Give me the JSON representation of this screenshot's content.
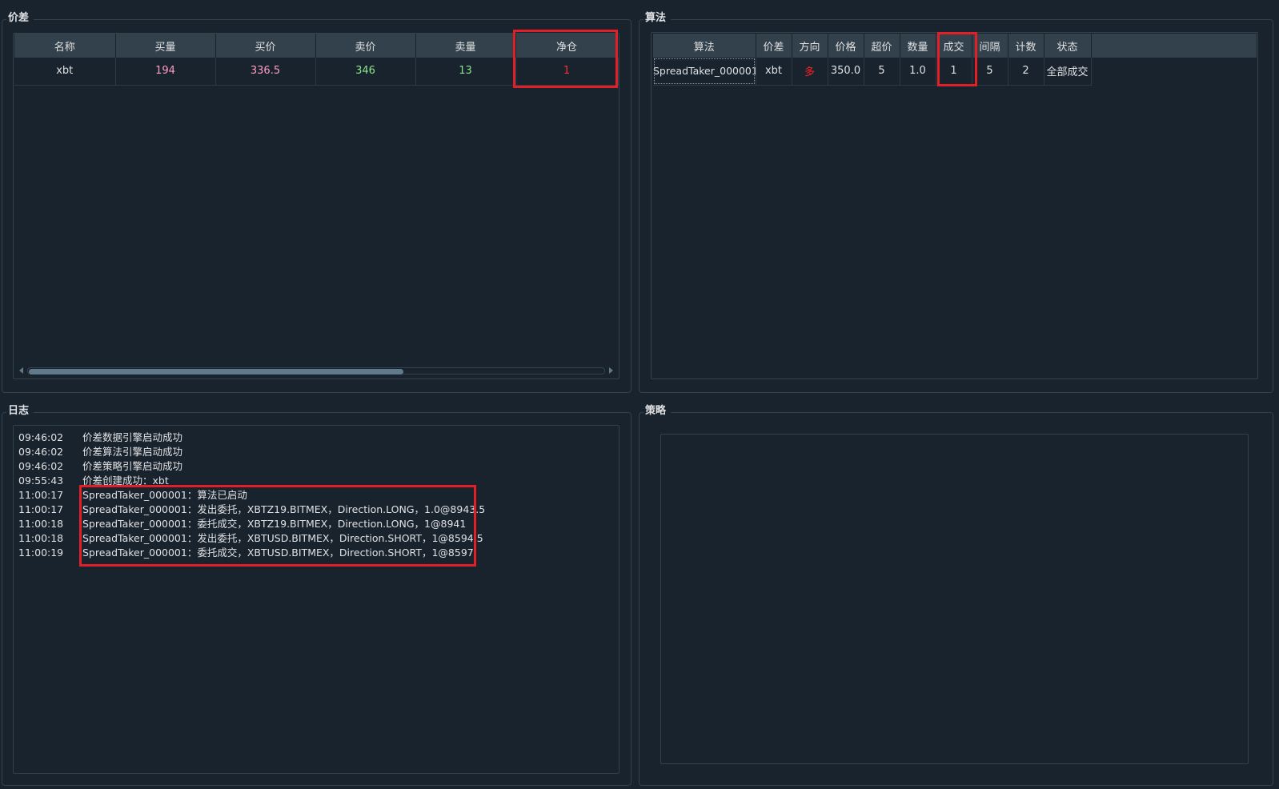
{
  "panels": {
    "spread": "价差",
    "algo": "算法",
    "log": "日志",
    "strategy": "策略"
  },
  "spread_table": {
    "headers": [
      "名称",
      "买量",
      "买价",
      "卖价",
      "卖量",
      "净仓"
    ],
    "rows": [
      {
        "name": "xbt",
        "bid_volume": "194",
        "bid_price": "336.5",
        "ask_price": "346",
        "ask_volume": "13",
        "net_pos": "1"
      }
    ]
  },
  "algo_table": {
    "headers": [
      "算法",
      "价差",
      "方向",
      "价格",
      "超价",
      "数量",
      "成交",
      "间隔",
      "计数",
      "状态"
    ],
    "rows": [
      {
        "algo": "SpreadTaker_000001",
        "spread": "xbt",
        "direction": "多",
        "price": "350.0",
        "payup": "5",
        "volume": "1.0",
        "traded": "1",
        "interval": "5",
        "count": "2",
        "status": "全部成交"
      }
    ]
  },
  "log": [
    {
      "time": "09:46:02",
      "msg": "价差数据引擎启动成功"
    },
    {
      "time": "09:46:02",
      "msg": "价差算法引擎启动成功"
    },
    {
      "time": "09:46:02",
      "msg": "价差策略引擎启动成功"
    },
    {
      "time": "09:55:43",
      "msg": "价差创建成功：xbt"
    },
    {
      "time": "11:00:17",
      "msg": "SpreadTaker_000001：算法已启动"
    },
    {
      "time": "11:00:17",
      "msg": "SpreadTaker_000001：发出委托，XBTZ19.BITMEX，Direction.LONG，1.0@8943.5"
    },
    {
      "time": "11:00:18",
      "msg": "SpreadTaker_000001：委托成交，XBTZ19.BITMEX，Direction.LONG，1@8941"
    },
    {
      "time": "11:00:18",
      "msg": "SpreadTaker_000001：发出委托，XBTUSD.BITMEX，Direction.SHORT，1@8594.5"
    },
    {
      "time": "11:00:19",
      "msg": "SpreadTaker_000001：委托成交，XBTUSD.BITMEX，Direction.SHORT，1@8597"
    }
  ],
  "colors": {
    "background": "#19232d",
    "header": "#32414b",
    "bid": "#ff9dc3",
    "ask": "#8ce58c",
    "net_pos": "#ff3030",
    "direction_long": "#ff2020",
    "highlight": "#e02026"
  }
}
